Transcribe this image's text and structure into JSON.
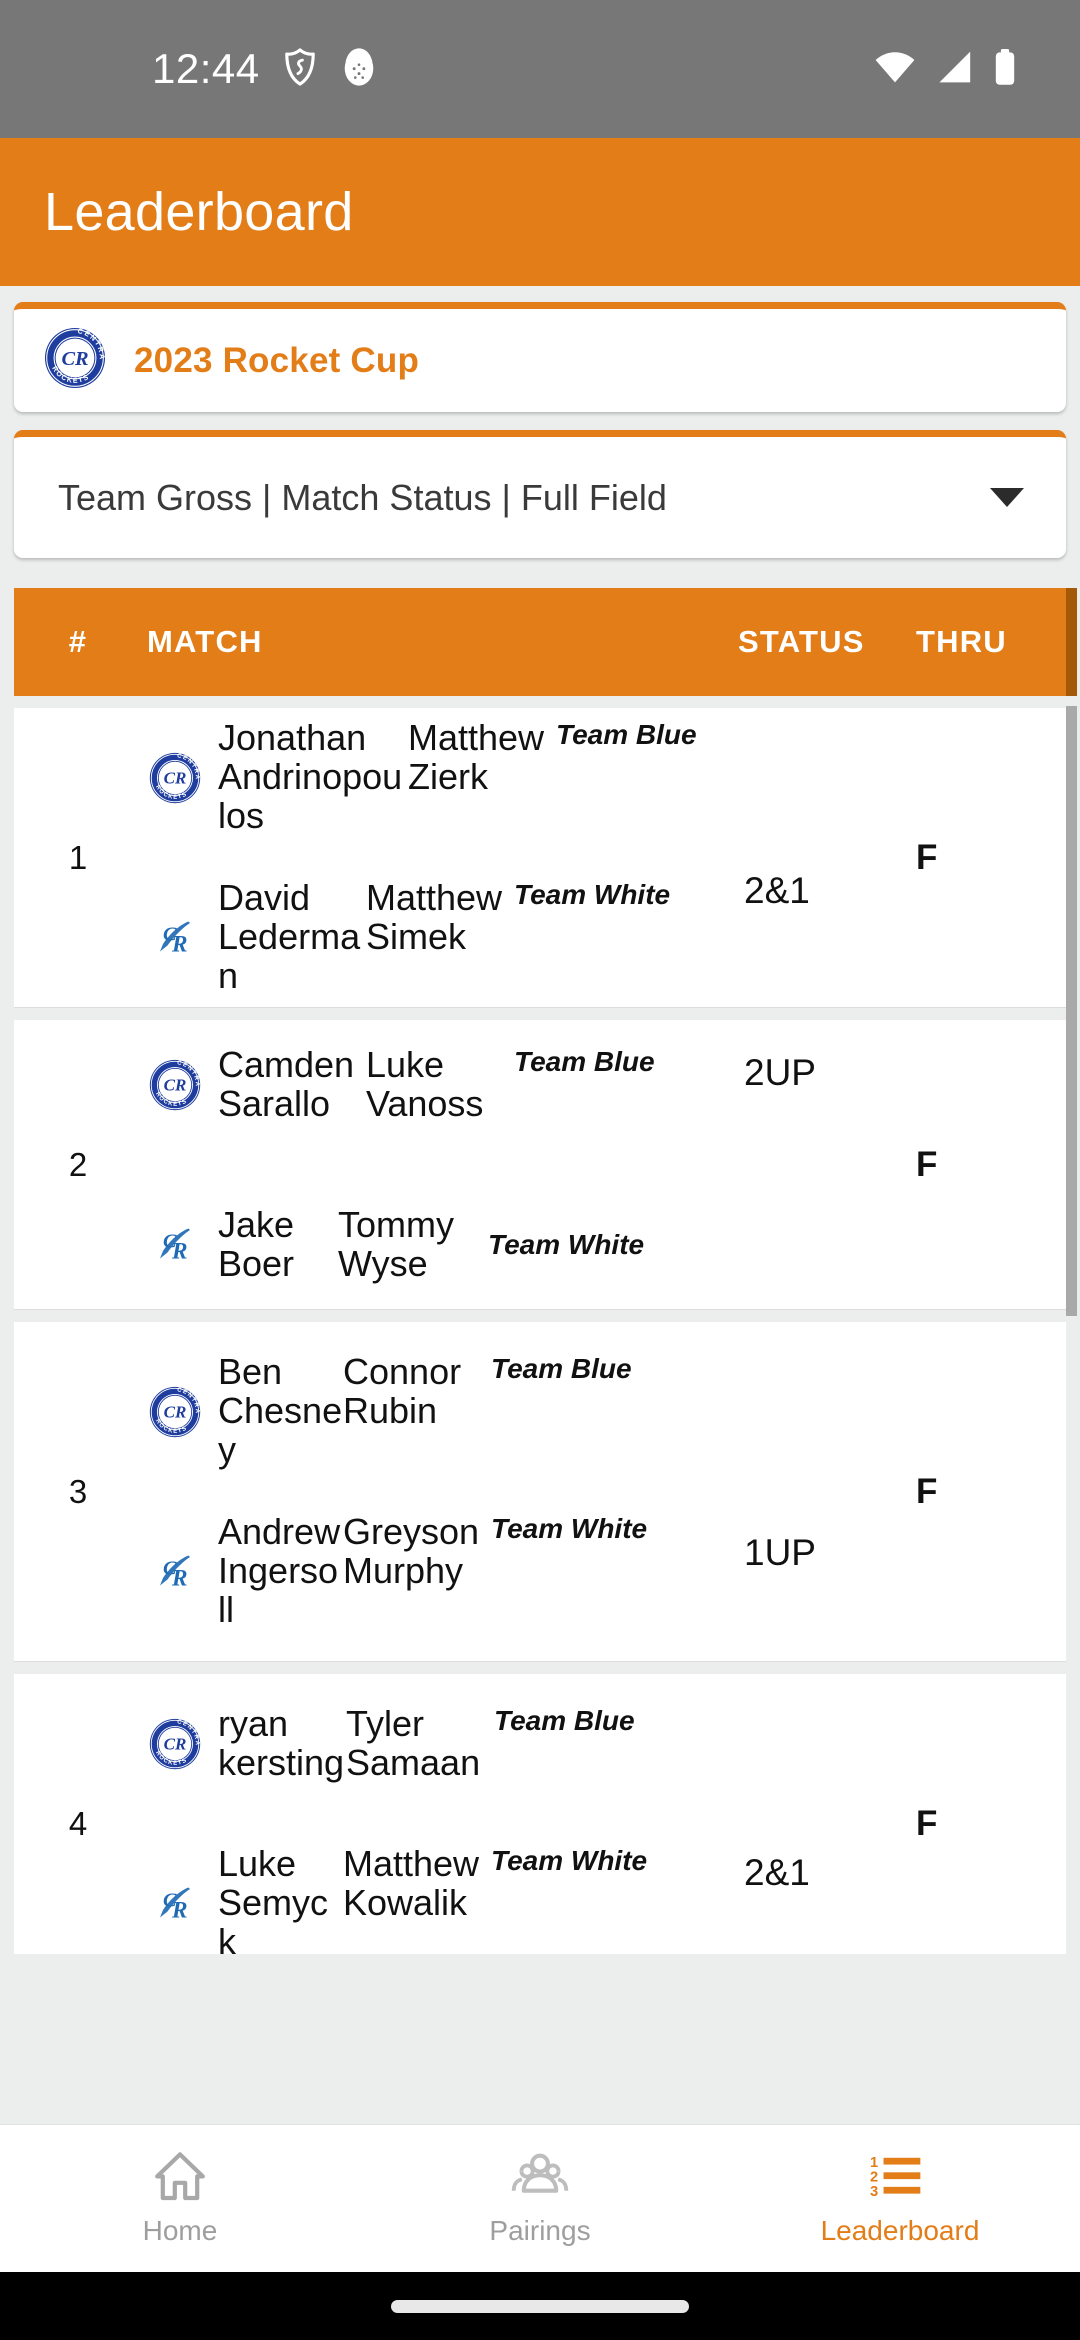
{
  "status_bar": {
    "time": "12:44",
    "left_icons": [
      "shield-icon",
      "egg-icon"
    ],
    "right_icons": [
      "wifi-icon",
      "cellular-signal-icon",
      "battery-icon"
    ]
  },
  "app_bar": {
    "title": "Leaderboard",
    "background": "#e27d18"
  },
  "tournament": {
    "name": "2023 Rocket Cup",
    "logo": "central-rockets-badge-icon",
    "accent": "#e27d18"
  },
  "filter": {
    "value": "Team Gross | Match Status | Full Field",
    "caret": "chevron-down-icon"
  },
  "table": {
    "columns": [
      "#",
      "MATCH",
      "STATUS",
      "THRU"
    ],
    "rows": [
      {
        "num": "1",
        "thru": "F",
        "sides": [
          {
            "logo": "central-rockets-badge-icon",
            "players": [
              "Jonathan Andrinopoulos",
              "Matthew Zierk"
            ],
            "team": "Team Blue",
            "status": ""
          },
          {
            "logo": "cr-script-icon",
            "players": [
              "David Lederman",
              "Matthew Simek"
            ],
            "team": "Team White",
            "status": "2&1"
          }
        ]
      },
      {
        "num": "2",
        "thru": "F",
        "sides": [
          {
            "logo": "central-rockets-badge-icon",
            "players": [
              "Camden Sarallo",
              "Luke Vanoss"
            ],
            "team": "Team Blue",
            "status": "2UP"
          },
          {
            "logo": "cr-script-icon",
            "players": [
              "Jake Boer",
              "Tommy Wyse"
            ],
            "team": "Team White",
            "status": ""
          }
        ]
      },
      {
        "num": "3",
        "thru": "F",
        "sides": [
          {
            "logo": "central-rockets-badge-icon",
            "players": [
              "Ben Chesney",
              "Connor Rubin"
            ],
            "team": "Team Blue",
            "status": ""
          },
          {
            "logo": "cr-script-icon",
            "players": [
              "Andrew Ingersoll",
              "Greyson Murphy"
            ],
            "team": "Team White",
            "status": "1UP"
          }
        ]
      },
      {
        "num": "4",
        "thru": "F",
        "sides": [
          {
            "logo": "central-rockets-badge-icon",
            "players": [
              "ryan kersting",
              "Tyler Samaan"
            ],
            "team": "Team Blue",
            "status": ""
          },
          {
            "logo": "cr-script-icon",
            "players": [
              "Luke Semyck",
              "Matthew Kowalik"
            ],
            "team": "Team White",
            "status": "2&1"
          }
        ]
      }
    ]
  },
  "bottom_nav": {
    "items": [
      {
        "label": "Home",
        "icon": "home-icon",
        "active": false
      },
      {
        "label": "Pairings",
        "icon": "people-icon",
        "active": false
      },
      {
        "label": "Leaderboard",
        "icon": "ranked-list-icon",
        "active": true
      }
    ],
    "active_color": "#e27d18",
    "inactive_color": "#9e9e9e"
  }
}
